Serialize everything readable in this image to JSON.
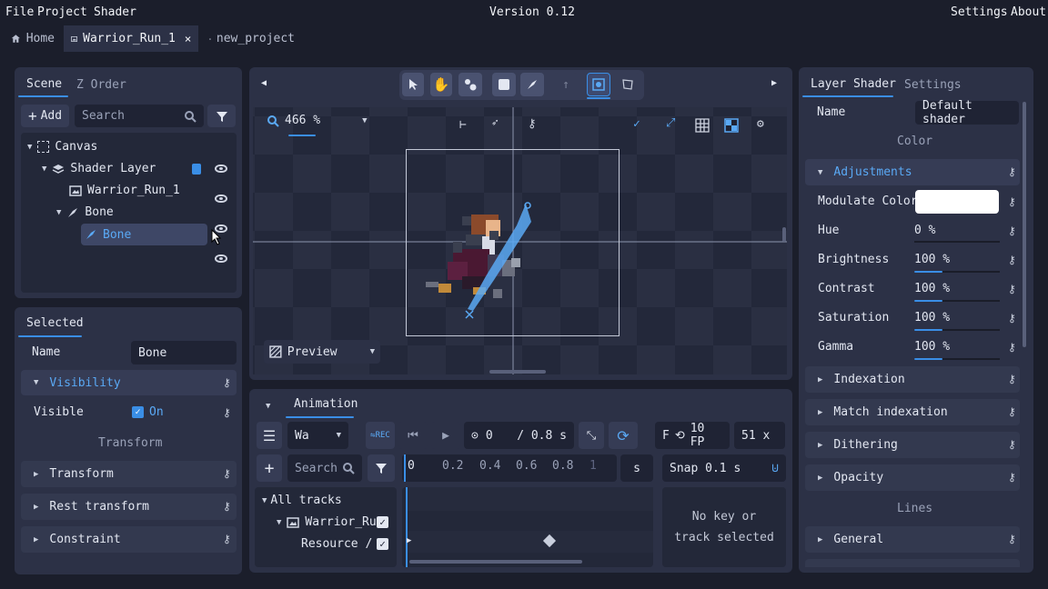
{
  "menu": {
    "file": "File",
    "project": "Project",
    "shader": "Shader",
    "version": "Version 0.12",
    "settings": "Settings",
    "about": "About"
  },
  "tabs": [
    {
      "label": "Home"
    },
    {
      "label": "Warrior_Run_1"
    },
    {
      "label": "new_project"
    }
  ],
  "scene": {
    "tab_scene": "Scene",
    "tab_zorder": "Z Order",
    "add": "Add",
    "search_placeholder": "Search",
    "tree": {
      "canvas": "Canvas",
      "shader_layer": "Shader Layer",
      "warrior": "Warrior_Run_1",
      "bone": "Bone",
      "bone_child": "Bone"
    }
  },
  "selected": {
    "tab": "Selected",
    "name_label": "Name",
    "name_value": "Bone",
    "visibility": "Visibility",
    "visible_label": "Visible",
    "visible_value": "On",
    "transform_header": "Transform",
    "transform": "Transform",
    "rest_transform": "Rest transform",
    "constraint": "Constraint"
  },
  "viewport": {
    "zoom": "466 %",
    "preview": "Preview"
  },
  "animation": {
    "tab": "Animation",
    "anim_name": "Wa",
    "time": "0",
    "duration": "/ 0.8 s",
    "fps_prefix": "F",
    "fps": "10 FP",
    "speed": "51 x",
    "search_placeholder": "Search",
    "ruler": [
      "0",
      "0.2",
      "0.4",
      "0.6",
      "0.8",
      "1"
    ],
    "unit": "s",
    "snap": "Snap  0.1 s",
    "all_tracks": "All tracks",
    "warrior_track": "Warrior_Ru",
    "resource_track": "Resource /",
    "empty": "No key or track selected"
  },
  "shader": {
    "tab_layer": "Layer Shader",
    "tab_settings": "Settings",
    "name_label": "Name",
    "name_value": "Default shader",
    "color_header": "Color",
    "adjustments": "Adjustments",
    "modulate": "Modulate Color",
    "props": [
      {
        "label": "Hue",
        "value": "0 %"
      },
      {
        "label": "Brightness",
        "value": "100 %"
      },
      {
        "label": "Contrast",
        "value": "100 %"
      },
      {
        "label": "Saturation",
        "value": "100 %"
      },
      {
        "label": "Gamma",
        "value": "100 %"
      }
    ],
    "indexation": "Indexation",
    "match_indexation": "Match indexation",
    "dithering": "Dithering",
    "opacity": "Opacity",
    "lines_header": "Lines",
    "general": "General"
  },
  "colors": {
    "accent": "#3a8ee6",
    "panel": "#2c3146",
    "background": "#1b1e2b"
  }
}
